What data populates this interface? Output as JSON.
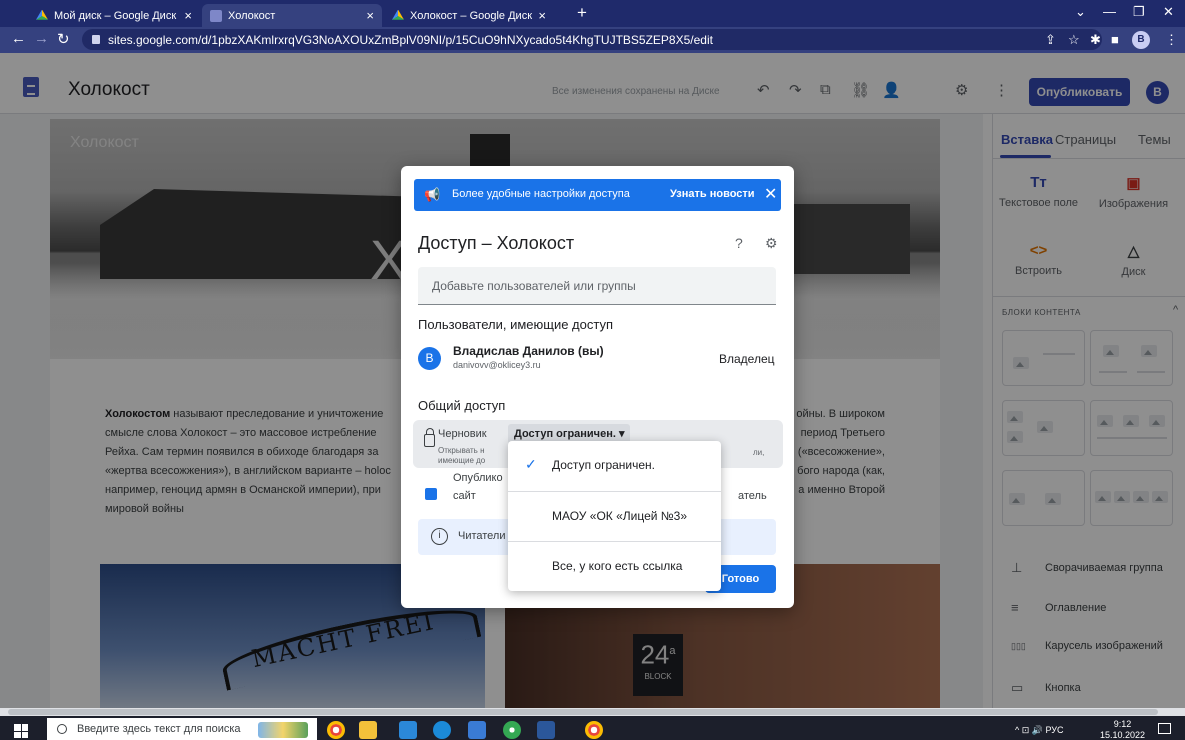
{
  "browser": {
    "tabs": [
      {
        "title": "Мой диск – Google Диск"
      },
      {
        "title": "Холокост"
      },
      {
        "title": "Холокост – Google Диск"
      }
    ],
    "url": "sites.google.com/d/1pbzXAKmlrxrqVG3NoAXOUxZmBplV09NI/p/15CuO9hNXycado5t4KhgTUJTBS5ZEP8X5/edit",
    "profile_initial": "B"
  },
  "header": {
    "site_title": "Холокост",
    "save_status": "Все изменения сохранены на Диске",
    "publish_label": "Опубликовать",
    "avatar_initial": "B"
  },
  "page": {
    "hero_brand": "Холокост",
    "hero_title": "Хо",
    "intro_bold": "Холокостом",
    "intro_lines": [
      " называют преследование и уничтожение",
      "смысле слова Холокост – это массовое истребление",
      "Рейха. Сам термин появился в обиходе благодаря за",
      "«жертва всесожжения»), в английском варианте – holoc",
      "например, геноцид армян в Османской империи), при",
      "мировой войны"
    ],
    "intro_right": [
      "ойны. В широком",
      "период Третьего",
      "(«всесожжение»,",
      "бого народа (как,",
      "а именно Второй"
    ],
    "photo_left_text": "MACHT FREI",
    "photo_right_number": "24",
    "photo_right_sup": "a",
    "photo_right_block": "BLOCK"
  },
  "right_panel": {
    "tabs": [
      "Вставка",
      "Страницы",
      "Темы"
    ],
    "tools": [
      {
        "icon": "Tт",
        "label": "Текстовое поле"
      },
      {
        "icon": "▣",
        "label": "Изображения"
      },
      {
        "icon": "<>",
        "label": "Встроить"
      },
      {
        "icon": "△",
        "label": "Диск"
      }
    ],
    "blocks_title": "БЛОКИ КОНТЕНТА",
    "components": [
      {
        "icon": "⊥",
        "label": "Сворачиваемая группа"
      },
      {
        "icon": "≡",
        "label": "Оглавление"
      },
      {
        "icon": "▯▯▯",
        "label": "Карусель изображений"
      },
      {
        "icon": "▭",
        "label": "Кнопка"
      }
    ]
  },
  "dialog": {
    "banner_text": "Более удобные настройки доступа",
    "banner_link": "Узнать новости",
    "title": "Доступ – Холокост",
    "add_placeholder": "Добавьте пользователей или группы",
    "users_section": "Пользователи, имеющие доступ",
    "user": {
      "initial": "B",
      "name": "Владислав Данилов (вы)",
      "email": "danivovv@oklicey3.ru",
      "role": "Владелец"
    },
    "general_section": "Общий доступ",
    "draft_label": "Черновик",
    "draft_value": "Доступ ограничен.",
    "draft_desc_1": "Открывать н",
    "draft_desc_2": "имеющие до",
    "draft_desc_tail": "ли,",
    "published_label": "Опубликов",
    "published_site": "сайт",
    "published_tail": "атель",
    "info_text": "Читатели",
    "info_tail": ".",
    "done_label": "Готово"
  },
  "menu": {
    "items": [
      {
        "label": "Доступ ограничен.",
        "selected": true
      },
      {
        "label": "МАОУ «ОК «Лицей №3»",
        "selected": false
      },
      {
        "label": "Все, у кого есть ссылка",
        "selected": false
      }
    ]
  },
  "taskbar": {
    "search_placeholder": "Введите здесь текст для поиска",
    "lang": "РУС",
    "time": "9:12",
    "date": "15.10.2022"
  },
  "colors": {
    "accent": "#3449b5",
    "google_blue": "#1a73e8",
    "chrome_frame": "#1f2a6b"
  }
}
